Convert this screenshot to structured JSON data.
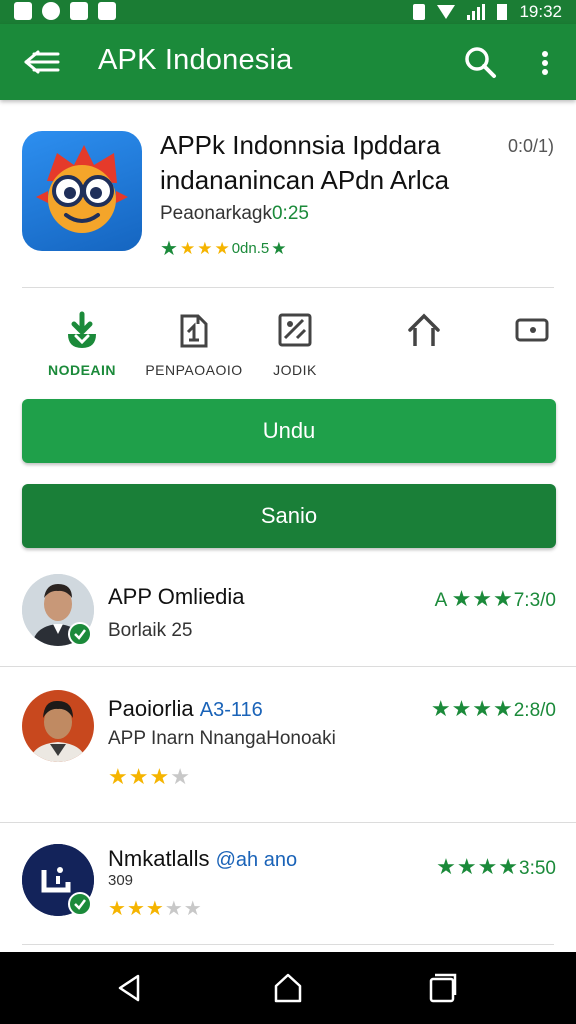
{
  "status_bar": {
    "time": "19:32"
  },
  "app_bar": {
    "title": "APK Indonesia"
  },
  "app": {
    "name": "APPk Indonnsia Ipddara indananincan APdn Arlca",
    "version": "0:0/1)",
    "publisher_prefix": "Peaonarkagk",
    "publisher_accent": "0:25",
    "rating_text": "0dn.5"
  },
  "actions": [
    {
      "label": "NODEAIN",
      "icon": "download-icon"
    },
    {
      "label": "PENPAOAOIO",
      "icon": "document-icon"
    },
    {
      "label": "JODIK",
      "icon": "image-icon"
    },
    {
      "label": "",
      "icon": "home-icon"
    },
    {
      "label": "",
      "icon": "media-icon"
    }
  ],
  "buttons": {
    "primary": "Undu",
    "secondary": "Sanio"
  },
  "reviews": [
    {
      "name": "APP Omliedia",
      "handle": "",
      "sub": "Borlaik 25",
      "right_prefix": "A",
      "right_value": "7:3/0",
      "stars": 0,
      "right_stars": "★★★"
    },
    {
      "name": "Paoiorlia",
      "handle": "A3-116",
      "sub": "APP Inarn NnangaHonoaki",
      "right_prefix": "",
      "right_value": "2:8/0",
      "stars": 3,
      "right_stars": "★★★★"
    },
    {
      "name": "Nmkatlalls",
      "handle": "@ah ano",
      "sub": "309",
      "right_prefix": "",
      "right_value": "3:50",
      "stars": 3,
      "right_stars": "★★★★"
    }
  ],
  "colors": {
    "primary": "#1b8a3a",
    "star": "#f5b400",
    "button_primary": "#1fa04a",
    "button_secondary": "#1a7f38"
  }
}
